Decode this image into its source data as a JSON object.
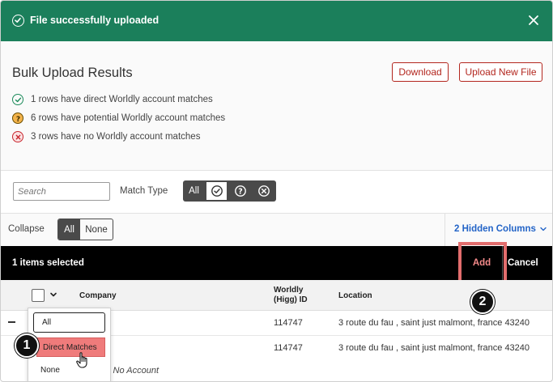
{
  "banner": {
    "message": "File successfully uploaded",
    "icons": {
      "status": "check-circle-icon",
      "close": "close-icon"
    },
    "color": "#1b7f5b"
  },
  "results": {
    "title": "Bulk Upload Results",
    "download_label": "Download",
    "upload_new_label": "Upload New File",
    "stats": [
      {
        "text": "1 rows have direct Worldly account matches",
        "icon": "check-circle-icon"
      },
      {
        "text": "6 rows have potential Worldly account matches",
        "icon": "question-circle-icon"
      },
      {
        "text": "3 rows have no Worldly account matches",
        "icon": "x-circle-icon"
      }
    ]
  },
  "filters": {
    "search_placeholder": "Search",
    "match_type_label": "Match Type",
    "match_all_label": "All",
    "match_options": [
      "check-circle-icon",
      "question-circle-icon",
      "x-circle-icon"
    ],
    "selected_match": "check-circle-icon"
  },
  "collapse": {
    "label": "Collapse",
    "all_label": "All",
    "none_label": "None",
    "selected": "All",
    "hidden_columns_label": "2 Hidden Columns"
  },
  "selection_bar": {
    "count_text": "1 items selected",
    "add_label": "Add",
    "cancel_label": "Cancel"
  },
  "table": {
    "columns": {
      "company": "Company",
      "worldly_id": "Worldly (Higg) ID",
      "location": "Location"
    },
    "rows": [
      {
        "worldly_id": "114747",
        "location": "3 route du fau , saint just malmont, france 43240"
      },
      {
        "worldly_id": "114747",
        "location": "3 route du fau , saint just malmont, france 43240"
      }
    ],
    "partial_text": "s No Account"
  },
  "dropdown": {
    "options": [
      "All",
      "Direct Matches",
      "None"
    ],
    "highlighted": "Direct Matches"
  },
  "callouts": [
    "1",
    "2"
  ],
  "accent_colors": {
    "primary_red": "#b3261e",
    "highlight_red": "#ef7b7b",
    "link_blue": "#2364c7"
  }
}
